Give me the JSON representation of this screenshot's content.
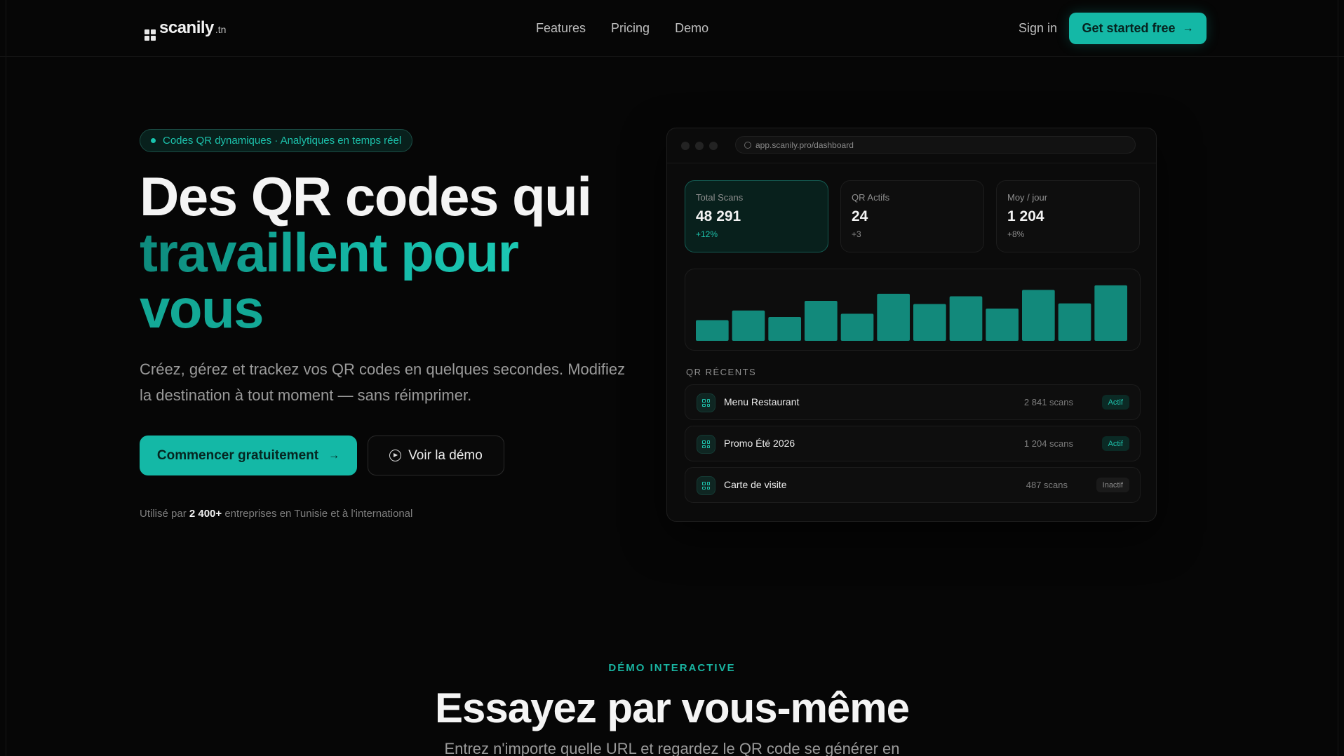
{
  "nav": {
    "logo_word": "scanily",
    "logo_tld": ".tn",
    "links": [
      "Features",
      "Pricing",
      "Demo"
    ],
    "signin": "Sign in",
    "cta": "Get started free"
  },
  "hero": {
    "badge": "Codes QR dynamiques · Analytiques en temps réel",
    "title_line1": "Des QR codes qui",
    "title_line2": "travaillent pour",
    "title_line3": "vous",
    "subtitle": "Créez, gérez et trackez vos QR codes en quelques secondes. Modifiez la destination à tout moment — sans réimprimer.",
    "primary_cta": "Commencer gratuitement",
    "secondary_cta": "Voir la démo",
    "social_prefix": "Utilisé par ",
    "social_count": "2 400+",
    "social_suffix": " entreprises en Tunisie et à l'international"
  },
  "dashboard": {
    "url": "app.scanily.pro/dashboard",
    "stats": [
      {
        "label": "Total Scans",
        "value": "48 291",
        "delta": "+12%"
      },
      {
        "label": "QR Actifs",
        "value": "24",
        "delta": "+3"
      },
      {
        "label": "Moy / jour",
        "value": "1 204",
        "delta": "+8%"
      }
    ],
    "recent_title": "QR RÉCENTS",
    "recent": [
      {
        "name": "Menu Restaurant",
        "scans": "2 841 scans",
        "status": "Actif"
      },
      {
        "name": "Promo Été 2026",
        "scans": "1 204 scans",
        "status": "Actif"
      },
      {
        "name": "Carte de visite",
        "scans": "487 scans",
        "status": "Inactif"
      }
    ],
    "accent": "#14b8a6"
  },
  "chart_data": {
    "type": "bar",
    "categories": [
      "",
      "",
      "",
      "",
      "",
      "",
      "",
      "",
      "",
      "",
      "",
      ""
    ],
    "values": [
      32,
      47,
      37,
      62,
      42,
      73,
      57,
      69,
      50,
      79,
      58,
      86
    ],
    "ylim": [
      0,
      100
    ],
    "title": "",
    "xlabel": "",
    "ylabel": ""
  },
  "demo": {
    "eyebrow": "DÉMO INTERACTIVE",
    "title": "Essayez par vous-même",
    "lead": "Entrez n'importe quelle URL et regardez le QR code se générer en"
  }
}
